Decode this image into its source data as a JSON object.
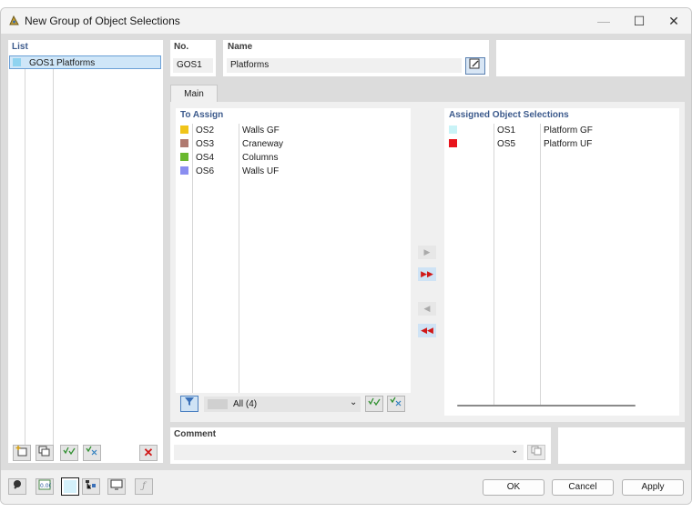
{
  "window": {
    "title": "New Group of Object Selections",
    "minimize": "—",
    "maximize": "☐",
    "close": "✕"
  },
  "list": {
    "header": "List",
    "items": [
      {
        "id": "GOS1",
        "name": "Platforms",
        "color": "#8fd3f0"
      }
    ]
  },
  "no": {
    "label": "No.",
    "value": "GOS1"
  },
  "name": {
    "label": "Name",
    "value": "Platforms"
  },
  "tabs": [
    {
      "label": "Main",
      "active": true
    }
  ],
  "to_assign": {
    "header": "To Assign",
    "items": [
      {
        "id": "OS2",
        "name": "Walls GF",
        "color": "#f0c419"
      },
      {
        "id": "OS3",
        "name": "Craneway",
        "color": "#b07a70"
      },
      {
        "id": "OS4",
        "name": "Columns",
        "color": "#6ab82e"
      },
      {
        "id": "OS6",
        "name": "Walls UF",
        "color": "#8a8ef0"
      }
    ],
    "filter_value": "All (4)"
  },
  "assigned": {
    "header": "Assigned Object Selections",
    "items": [
      {
        "id": "OS1",
        "name": "Platform GF",
        "color": "#c9f3f7"
      },
      {
        "id": "OS5",
        "name": "Platform UF",
        "color": "#e8141c"
      }
    ]
  },
  "comment": {
    "label": "Comment",
    "value": ""
  },
  "buttons": {
    "ok": "OK",
    "cancel": "Cancel",
    "apply": "Apply"
  }
}
